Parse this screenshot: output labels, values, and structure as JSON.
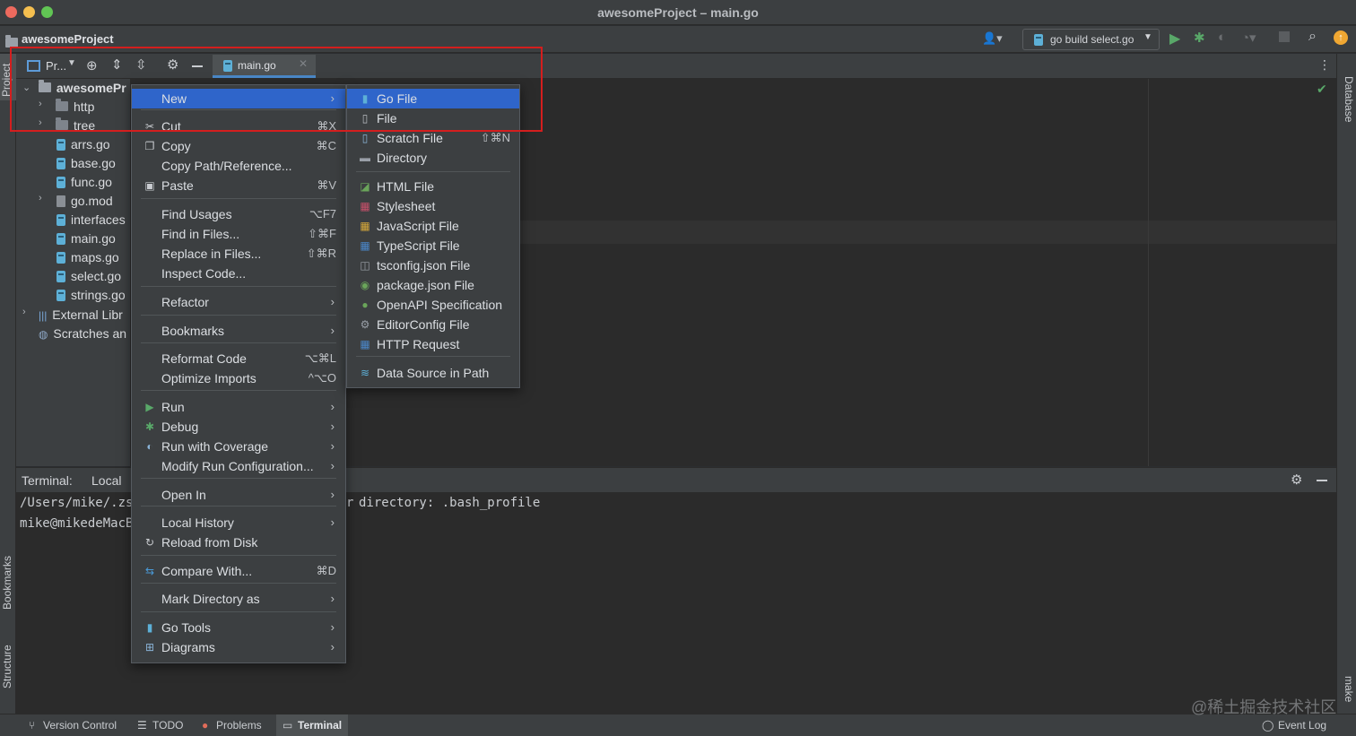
{
  "window": {
    "title": "awesomeProject – main.go"
  },
  "navbar": {
    "project_name": "awesomeProject",
    "run_config": "go build select.go"
  },
  "tool_header": {
    "project_view": "Pr...",
    "active_tab": "main.go"
  },
  "left_strip": {
    "project": "Project",
    "bookmarks": "Bookmarks",
    "structure": "Structure"
  },
  "right_strip": {
    "database": "Database",
    "make": "make"
  },
  "tree": {
    "root": "awesomePr",
    "items": [
      {
        "label": "http",
        "kind": "folder"
      },
      {
        "label": "tree",
        "kind": "folder"
      },
      {
        "label": "arrs.go",
        "kind": "go"
      },
      {
        "label": "base.go",
        "kind": "go"
      },
      {
        "label": "func.go",
        "kind": "go"
      },
      {
        "label": "go.mod",
        "kind": "mod"
      },
      {
        "label": "interfaces",
        "kind": "go"
      },
      {
        "label": "main.go",
        "kind": "go"
      },
      {
        "label": "maps.go",
        "kind": "go"
      },
      {
        "label": "select.go",
        "kind": "go"
      },
      {
        "label": "strings.go",
        "kind": "go"
      }
    ],
    "external": "External Libr",
    "scratches": "Scratches an"
  },
  "context_menu": {
    "items": [
      {
        "label": "New",
        "shortcut": "",
        "submenu": true,
        "highlighted": true
      },
      {
        "label": "Cut",
        "shortcut": "⌘X",
        "icon": "scissors-icon"
      },
      {
        "label": "Copy",
        "shortcut": "⌘C",
        "icon": "copy-icon"
      },
      {
        "label": "Copy Path/Reference...",
        "shortcut": ""
      },
      {
        "label": "Paste",
        "shortcut": "⌘V",
        "icon": "paste-icon"
      },
      {
        "label": "Find Usages",
        "shortcut": "⌥F7"
      },
      {
        "label": "Find in Files...",
        "shortcut": "⇧⌘F"
      },
      {
        "label": "Replace in Files...",
        "shortcut": "⇧⌘R"
      },
      {
        "label": "Inspect Code..."
      },
      {
        "label": "Refactor",
        "submenu": true
      },
      {
        "label": "Bookmarks",
        "submenu": true
      },
      {
        "label": "Reformat Code",
        "shortcut": "⌥⌘L"
      },
      {
        "label": "Optimize Imports",
        "shortcut": "^⌥O"
      },
      {
        "label": "Run",
        "submenu": true,
        "icon": "run-icon"
      },
      {
        "label": "Debug",
        "submenu": true,
        "icon": "debug-icon"
      },
      {
        "label": "Run with Coverage",
        "submenu": true,
        "icon": "coverage-icon"
      },
      {
        "label": "Modify Run Configuration...",
        "submenu": true
      },
      {
        "label": "Open In",
        "submenu": true
      },
      {
        "label": "Local History",
        "submenu": true
      },
      {
        "label": "Reload from Disk",
        "icon": "reload-icon"
      },
      {
        "label": "Compare With...",
        "shortcut": "⌘D",
        "icon": "compare-icon"
      },
      {
        "label": "Mark Directory as",
        "submenu": true
      },
      {
        "label": "Go Tools",
        "submenu": true,
        "icon": "gopher-icon"
      },
      {
        "label": "Diagrams",
        "submenu": true,
        "icon": "diagram-icon"
      }
    ]
  },
  "new_submenu": {
    "items": [
      {
        "label": "Go File",
        "highlighted": true
      },
      {
        "label": "File"
      },
      {
        "label": "Scratch File",
        "shortcut": "⇧⌘N"
      },
      {
        "label": "Directory"
      },
      {
        "label": "HTML File"
      },
      {
        "label": "Stylesheet"
      },
      {
        "label": "JavaScript File"
      },
      {
        "label": "TypeScript File"
      },
      {
        "label": "tsconfig.json File"
      },
      {
        "label": "package.json File"
      },
      {
        "label": "OpenAPI Specification"
      },
      {
        "label": "EditorConfig File"
      },
      {
        "label": "HTTP Request"
      },
      {
        "label": "Data Source in Path"
      }
    ]
  },
  "terminal": {
    "title": "Terminal:",
    "tab": "Local",
    "line1_left": "/Users/mike/.zs",
    "line1_right": "directory: .bash_profile",
    "line2": "mike@mikedeMacB"
  },
  "statusbar": {
    "version_control": "Version Control",
    "todo": "TODO",
    "problems": "Problems",
    "terminal": "Terminal",
    "event_log": "Event Log"
  },
  "watermark": "@稀土掘金技术社区",
  "colors": {
    "accent": "#2f65ca",
    "highlight_box": "#d41e1e",
    "run_green": "#59a869"
  }
}
